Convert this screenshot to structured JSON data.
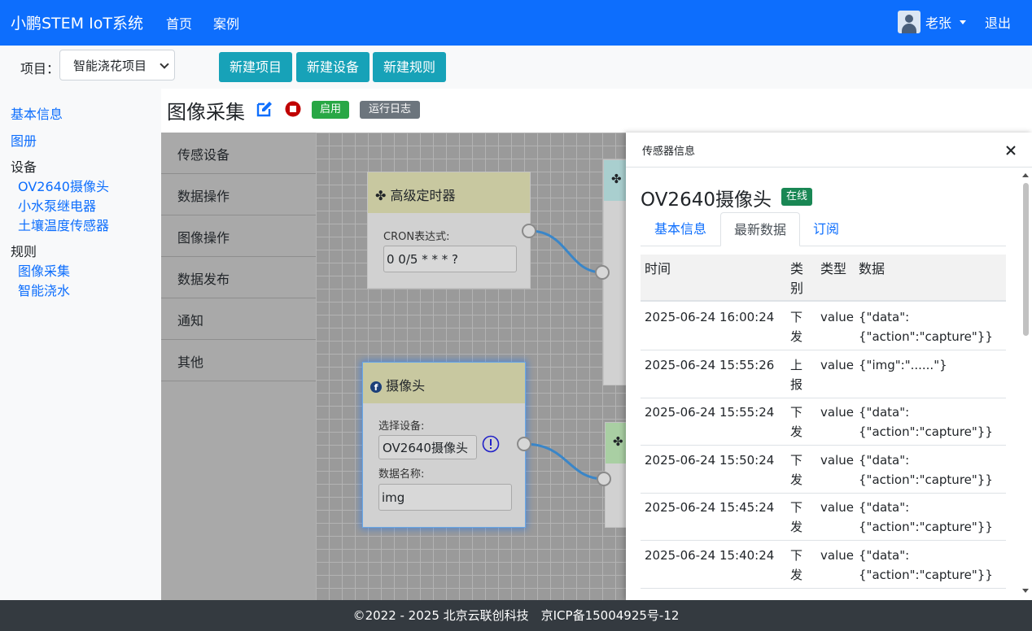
{
  "navbar": {
    "brand": "小鹏STEM IoT系统",
    "links": [
      "首页",
      "案例"
    ],
    "user": "老张",
    "logout": "退出"
  },
  "toolbar": {
    "project_label": "项目：",
    "project_selected": "智能浇花项目",
    "buttons": [
      "新建项目",
      "新建设备",
      "新建规则"
    ]
  },
  "sidebar": {
    "basic_info": "基本信息",
    "album": "图册",
    "devices_heading": "设备",
    "devices": [
      "OV2640摄像头",
      "小水泵继电器",
      "土壤温度传感器"
    ],
    "rules_heading": "规则",
    "rules": [
      "图像采集",
      "智能浇水"
    ]
  },
  "rule": {
    "title": "图像采集",
    "status_badge": "启用",
    "log_badge": "运行日志"
  },
  "node_panel": [
    "传感设备",
    "数据操作",
    "图像操作",
    "数据发布",
    "通知",
    "其他"
  ],
  "nodes": {
    "timer": {
      "title": "高级定时器",
      "field_label": "CRON表达式:",
      "field_value": "0 0/5 * * * ?"
    },
    "camera": {
      "title": "摄像头",
      "device_label": "选择设备:",
      "device_value": "OV2640摄像头",
      "data_label": "数据名称:",
      "data_value": "img"
    }
  },
  "panel": {
    "header": "传感器信息",
    "device_name": "OV2640摄像头",
    "online": "在线",
    "tabs": [
      "基本信息",
      "最新数据",
      "订阅"
    ],
    "active_tab": "最新数据",
    "columns": [
      "时间",
      "类别",
      "类型",
      "数据"
    ],
    "rows": [
      {
        "time": "2025-06-24 16:00:24",
        "cat": "下发",
        "type": "value",
        "data1": "{\"data\":",
        "data2": "{\"action\":\"capture\"}}"
      },
      {
        "time": "2025-06-24 15:55:26",
        "cat": "上报",
        "type": "value",
        "data1": "{\"img\":\"......\"}",
        "data2": ""
      },
      {
        "time": "2025-06-24 15:55:24",
        "cat": "下发",
        "type": "value",
        "data1": "{\"data\":",
        "data2": "{\"action\":\"capture\"}}"
      },
      {
        "time": "2025-06-24 15:50:24",
        "cat": "下发",
        "type": "value",
        "data1": "{\"data\":",
        "data2": "{\"action\":\"capture\"}}"
      },
      {
        "time": "2025-06-24 15:45:24",
        "cat": "下发",
        "type": "value",
        "data1": "{\"data\":",
        "data2": "{\"action\":\"capture\"}}"
      },
      {
        "time": "2025-06-24 15:40:24",
        "cat": "下发",
        "type": "value",
        "data1": "{\"data\":",
        "data2": "{\"action\":\"capture\"}}"
      }
    ]
  },
  "footer": "©2022 - 2025 北京云联创科技　京ICP备15004925号-12",
  "colors": {
    "primary": "#0d6efd",
    "info": "#17a2b8",
    "success": "#28a745",
    "secondary": "#6c757d",
    "danger": "#dc3545"
  }
}
